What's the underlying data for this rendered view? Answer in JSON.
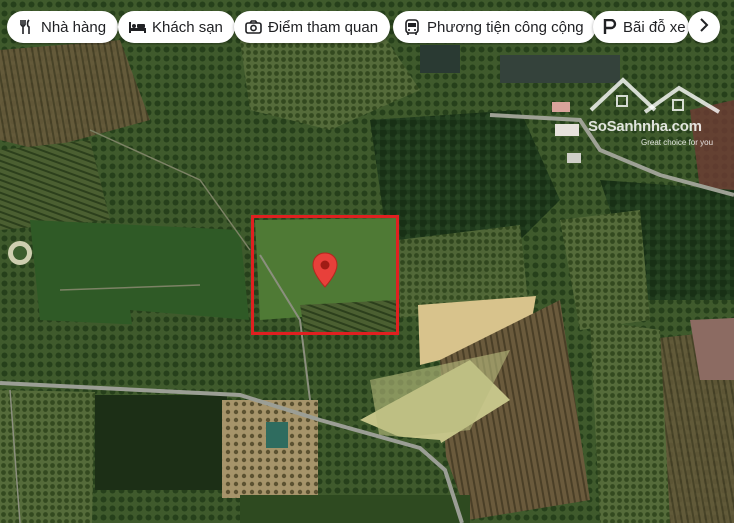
{
  "filter_chips": [
    {
      "label": "Nhà hàng",
      "icon": "fork-knife-icon"
    },
    {
      "label": "Khách sạn",
      "icon": "bed-icon"
    },
    {
      "label": "Điểm tham quan",
      "icon": "camera-icon"
    },
    {
      "label": "Phương tiện công cộng",
      "icon": "bus-icon"
    },
    {
      "label": "Bãi đỗ xe",
      "icon": "parking-icon"
    }
  ],
  "more_button": {
    "icon": "chevron-right-icon"
  },
  "watermark": {
    "name": "SoSanhnha.com",
    "tagline": "Great choice for you"
  },
  "map": {
    "type": "satellite",
    "pin_color": "#e8403a",
    "selection_color": "#e02020"
  }
}
